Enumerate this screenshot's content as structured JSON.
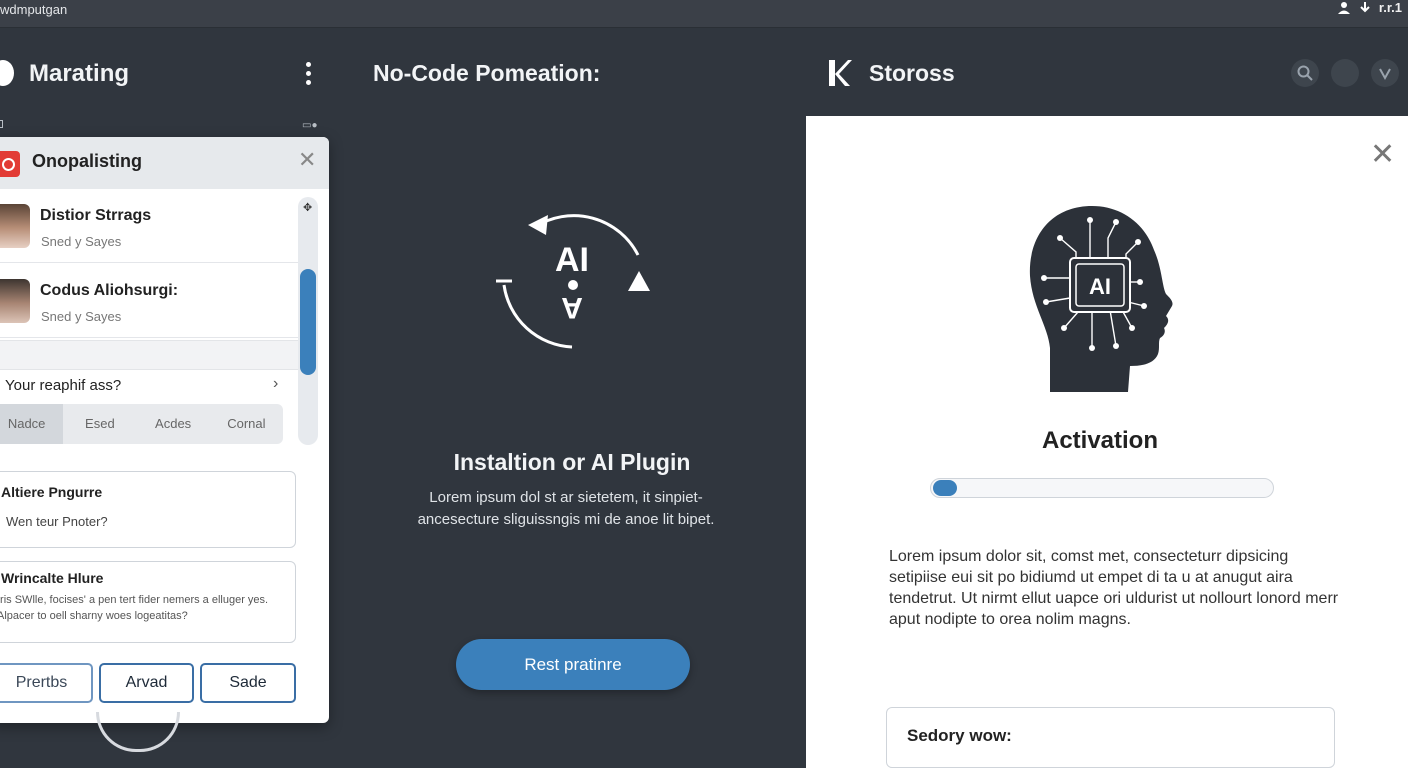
{
  "topbar": {
    "title": "wdmputgan",
    "icons": [
      "person-icon",
      "download-icon",
      "grid-icon"
    ],
    "icon_text": "r.r.1"
  },
  "left": {
    "brand_title": "Marating",
    "panel": {
      "title": "Onopalisting",
      "contacts": [
        {
          "name": "Distior Strrags",
          "subtitle": "Sned y Sayes"
        },
        {
          "name": "Codus Aliohsurgi:",
          "subtitle": "Sned y Sayes"
        }
      ],
      "question": "Your reaphif ass?",
      "segments": [
        "Nadce",
        "Esed",
        "Acdes",
        "Cornal"
      ],
      "field1": {
        "label": "Altiere Pngurre",
        "value": "Wen teur Pnoter?"
      },
      "field2": {
        "label": "Wrincalte Hlure",
        "text": "Iris SWlle, focises' a pen tert fider nemers a elluger yes. Alpacer to oell sharny woes logeatitas?"
      },
      "buttons": [
        "Prertbs",
        "Arvad",
        "Sade"
      ]
    }
  },
  "middle": {
    "title": "No-Code Pomeation:",
    "ai_label": "AI",
    "heading": "Instaltion or AI Plugin",
    "description": "Lorem ipsum dol st ar sietetem, it sinpiet-ancesecture sliguissngis mi de anoe lit bipet.",
    "cta": "Rest pratinre"
  },
  "right": {
    "title": "Stoross",
    "header_icons": [
      "search-icon",
      "notification-icon",
      "profile-icon"
    ],
    "chip_label": "AI",
    "heading": "Activation",
    "progress": 0.07,
    "text": "Lorem ipsum dolor sit, comst met, consecteturr dipsicing setipiise eui sit po bidiumd ut empet di ta u at anugut aira tendetrut. Ut nirmt ellut uapce ori uldurist ut nollourt lonord merr aput nodipte to orea nolim magns.",
    "field_label": "Sedory wow:"
  },
  "colors": {
    "background": "#30363e",
    "accent": "#3b80bb",
    "danger": "#e23b35"
  }
}
